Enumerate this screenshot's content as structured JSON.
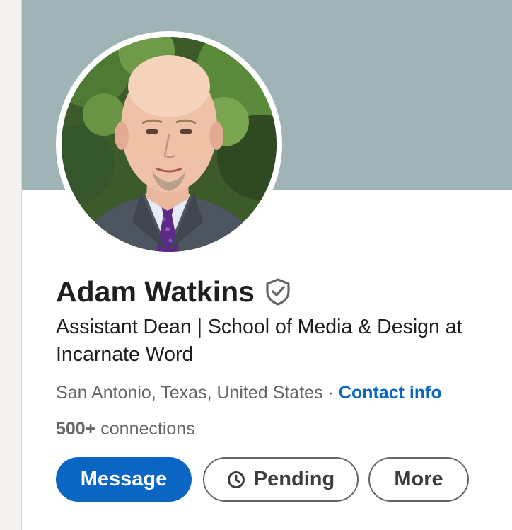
{
  "profile": {
    "name": "Adam Watkins",
    "headline_line1": "Assistant Dean | School of Media & Design at",
    "headline_line2": "Incarnate Word",
    "location": "San Antonio, Texas, United States",
    "separator": "·",
    "contact_info": "Contact info",
    "connections_count": "500+",
    "connections_label": "connections",
    "verified_icon": "verified-shield-icon",
    "avatar_description_icon": "profile-photo"
  },
  "actions": {
    "message": "Message",
    "pending": "Pending",
    "more": "More",
    "pending_icon": "clock-icon"
  },
  "colors": {
    "banner": "#a0b4b7",
    "primary": "#0a66c2",
    "text": "#1f1f1f",
    "muted": "#666666"
  }
}
